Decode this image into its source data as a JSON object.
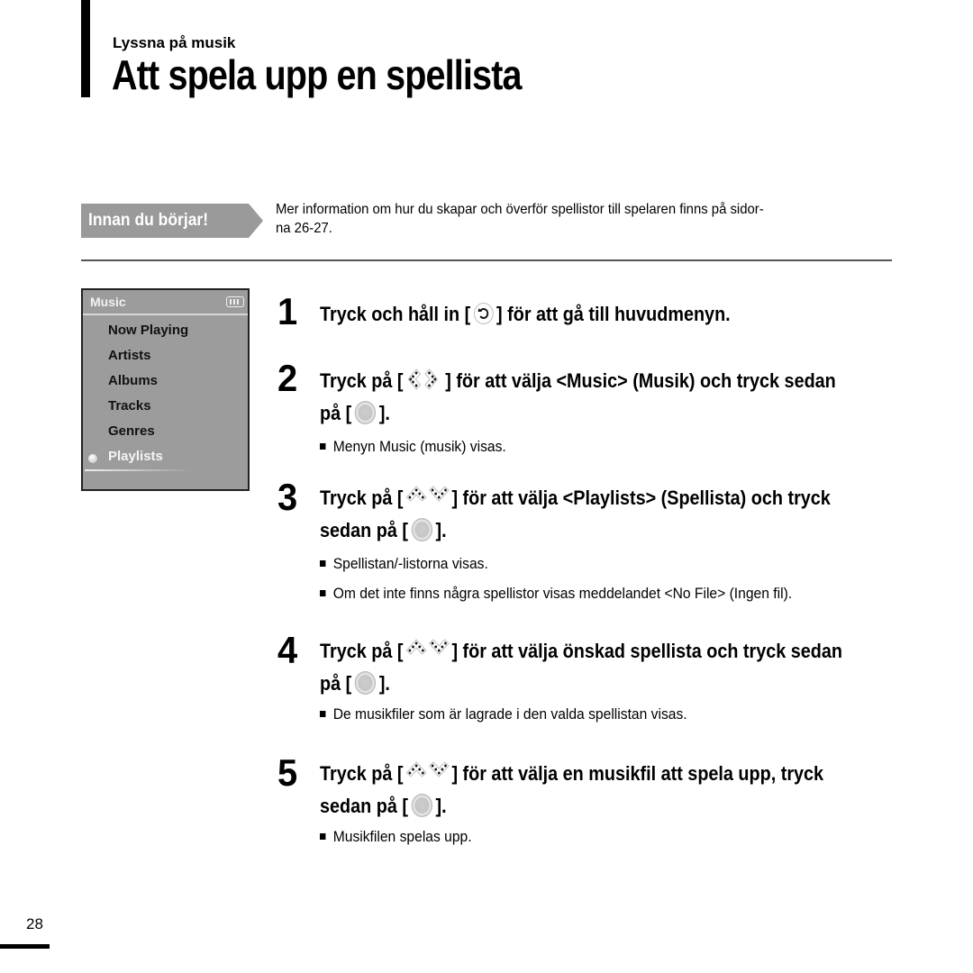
{
  "header": {
    "section_label": "Lyssna på musik",
    "title": "Att spela upp en spellista"
  },
  "note": {
    "badge": "Innan du börjar!",
    "text_line1": "Mer information om hur du skapar och överför spellistor till spelaren finns på sidor-",
    "text_line2": "na 26-27."
  },
  "device_screen": {
    "title": "Music",
    "battery_icon": "battery-full-icon",
    "items": [
      {
        "label": "Now Playing",
        "selected": false
      },
      {
        "label": "Artists",
        "selected": false
      },
      {
        "label": "Albums",
        "selected": false
      },
      {
        "label": "Tracks",
        "selected": false
      },
      {
        "label": "Genres",
        "selected": false
      },
      {
        "label": "Playlists",
        "selected": true
      }
    ]
  },
  "steps": [
    {
      "number": "1",
      "pre": "Tryck och håll in [",
      "icon1": "back-icon",
      "post": "] för att gå till huvudmenyn."
    },
    {
      "number": "2",
      "pre": "Tryck på [",
      "icon1": "left-right-icon",
      "post": "] för att välja <Music> (Musik) och tryck sedan",
      "line2_pre": "på [",
      "icon2": "select-button-icon",
      "line2_post": "].",
      "bullets": [
        "Menyn Music (musik) visas."
      ]
    },
    {
      "number": "3",
      "pre": "Tryck på [",
      "icon1": "up-down-icon",
      "post": "] för att välja <Playlists> (Spellista) och tryck",
      "line2_pre": "sedan på [",
      "icon2": "select-button-icon",
      "line2_post": "].",
      "bullets": [
        "Spellistan/-listorna visas.",
        "Om det inte finns några spellistor visas meddelandet <No File> (Ingen fil)."
      ]
    },
    {
      "number": "4",
      "pre": "Tryck på [",
      "icon1": "up-down-icon",
      "post": "] för att välja önskad spellista och tryck sedan",
      "line2_pre": "på [",
      "icon2": "select-button-icon",
      "line2_post": "].",
      "bullets": [
        "De musikfiler som är lagrade i den valda spellistan visas."
      ]
    },
    {
      "number": "5",
      "pre": "Tryck på [",
      "icon1": "up-down-icon",
      "post": "] för att välja en musikfil att spela upp, tryck",
      "line2_pre": "sedan på [",
      "icon2": "select-button-icon",
      "line2_post": "].",
      "bullets": [
        "Musikfilen spelas upp."
      ]
    }
  ],
  "footer": {
    "page_number": "28"
  }
}
